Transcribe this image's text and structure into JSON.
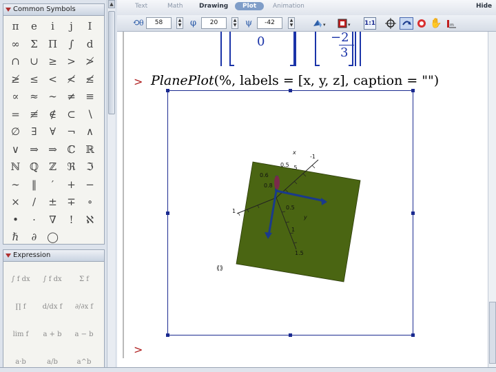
{
  "palettes": {
    "common_symbols": {
      "title": "Common Symbols",
      "symbols": [
        "π",
        "e",
        "i",
        "j",
        "I",
        "∞",
        "Σ",
        "Π",
        "∫",
        "d",
        "∩",
        "∪",
        "≥",
        ">",
        "≯",
        "≱",
        "≤",
        "<",
        "≮",
        "≰",
        "∝",
        "≈",
        "∼",
        "≠",
        "≡",
        "=",
        "≢",
        "∉",
        "⊂",
        "∖",
        "∅",
        "∃",
        "∀",
        "¬",
        "∧",
        "∨",
        "⇒",
        "⇒",
        "ℂ",
        "ℝ",
        "ℕ",
        "ℚ",
        "ℤ",
        "ℜ",
        "ℑ",
        "∼",
        "‖",
        "′",
        "+",
        "−",
        "×",
        "/",
        "±",
        "∓",
        "∘",
        "•",
        "·",
        "∇",
        "!",
        "ℵ",
        "ℏ",
        "∂",
        "◯"
      ]
    },
    "expression": {
      "title": "Expression",
      "items": [
        "∫ f dx",
        "∫ f dx",
        "Σ f",
        "∏ f",
        "d/dx f",
        "∂/∂x f",
        "lim f",
        "a + b",
        "a − b",
        "a·b",
        "a/b",
        "a^b"
      ]
    }
  },
  "tabs": [
    "Text",
    "Math",
    "Drawing",
    "Plot",
    "Animation"
  ],
  "active_tab": "Plot",
  "hide_label": "Hide",
  "toolbar": {
    "theta_symbol": "θ",
    "theta_value": "58",
    "phi_symbol": "φ",
    "phi_value": "20",
    "psi_symbol": "ψ",
    "psi_value": "-42",
    "ratio_label": "1:1"
  },
  "worksheet": {
    "matrix_zero": "0",
    "matrix_frac_num": "2",
    "matrix_frac_den": "3",
    "command_fn": "PlanePlot",
    "command_args": "(%, labels = [x, y, z], caption = \"\")",
    "prompt_symbol": ">"
  },
  "plot": {
    "plane_color": "#4a6512",
    "axis_color": "#1a3a8c",
    "tick_labels_x": [
      "0.5",
      "1",
      "-1"
    ],
    "tick_labels_y": [
      "0.6",
      "0.8",
      "1",
      "0.5",
      "1",
      "1.5"
    ],
    "axis_labels": [
      "x",
      "y",
      "1"
    ]
  }
}
